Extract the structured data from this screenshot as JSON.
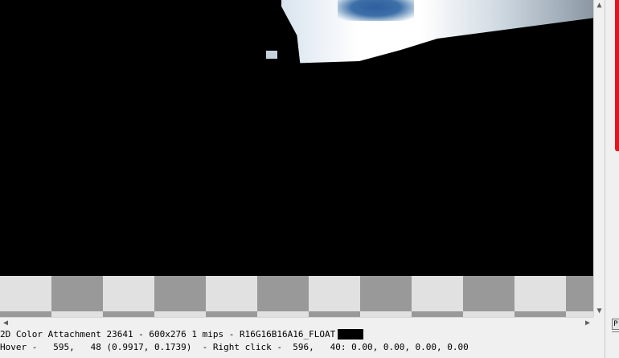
{
  "viewer": {
    "texture_name": "2D Color Attachment 23641",
    "dimensions": "600x276",
    "mips": "1 mips",
    "format": "R16G16B16A16_FLOAT",
    "swatch_color": "#000000"
  },
  "status": {
    "line1": "2D Color Attachment 23641 - 600x276 1 mips - R16G16B16A16_FLOAT",
    "line2": "Hover -   595,   48 (0.9917, 0.1739)  - Right click -  596,   40: 0.00, 0.00, 0.00, 0.00"
  },
  "scrollbars": {
    "up_icon": "chevron-up-icon",
    "down_icon": "chevron-down-icon",
    "left_icon": "chevron-left-icon",
    "right_icon": "chevron-right-icon",
    "up": "▲",
    "down": "▼",
    "left": "◀",
    "right": "▶"
  },
  "side_panel": {
    "button_label": "P",
    "accent_color": "#e8141c"
  },
  "checker_colors": {
    "light": "#e1e1e1",
    "dark": "#999999"
  }
}
